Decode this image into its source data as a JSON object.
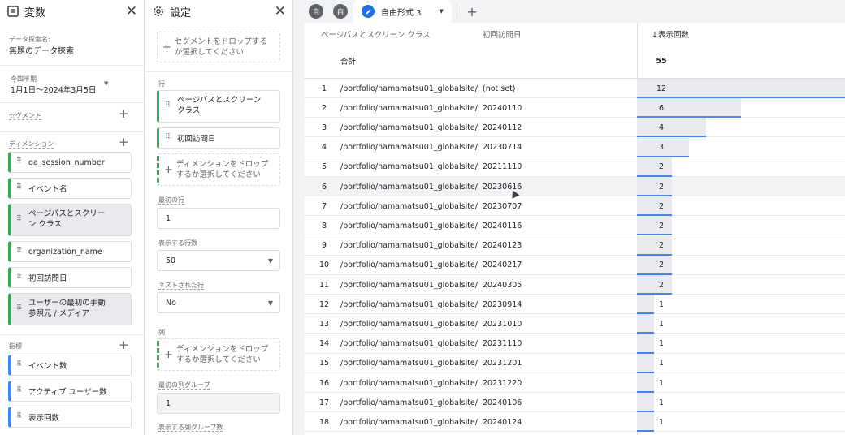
{
  "variables": {
    "title": "変数",
    "exploration_label": "データ探索名:",
    "exploration_name": "無題のデータ探索",
    "date_preset": "今四半期",
    "date_range": "1月1日～2024年3月5日",
    "segments_label": "セグメント",
    "dimensions_label": "ディメンション",
    "dimensions": [
      "ga_session_number",
      "イベント名",
      "ページパスとスクリーン クラス",
      "organization_name",
      "初回訪問日",
      "ユーザーの最初の手動参照元 / メディア"
    ],
    "metrics_label": "指標",
    "metrics": [
      "イベント数",
      "アクティブ ユーザー数",
      "表示回数"
    ]
  },
  "settings": {
    "title": "設定",
    "segment_drop": "セグメントをドロップするか選択してください",
    "rows_label": "行",
    "rows": [
      "ページパスとスクリーン クラス",
      "初回訪問日"
    ],
    "dimension_drop": "ディメンションをドロップするか選択してください",
    "first_row_label": "最初の行",
    "first_row_value": "1",
    "show_rows_label": "表示する行数",
    "show_rows_value": "50",
    "nested_label": "ネストされた行",
    "nested_value": "No",
    "columns_label": "列",
    "column_drop": "ディメンションをドロップするか選択してください",
    "first_col_group_label": "最初の列グループ",
    "first_col_group_value": "1",
    "show_col_groups_label": "表示する列グループ数"
  },
  "tabs": {
    "icon1": "自",
    "icon2": "自",
    "active_label": "自由形式 3"
  },
  "table": {
    "header_dim1": "ページパスとスクリーン クラス",
    "header_dim2": "初回訪問日",
    "header_metric": "↓表示回数",
    "total_label": "合計",
    "total_value": "55",
    "rows": [
      {
        "n": "1",
        "path": "/portfolio/hamamatsu01_globalsite/",
        "date": "(not set)",
        "views": "12",
        "v": 12
      },
      {
        "n": "2",
        "path": "/portfolio/hamamatsu01_globalsite/",
        "date": "20240110",
        "views": "6",
        "v": 6
      },
      {
        "n": "3",
        "path": "/portfolio/hamamatsu01_globalsite/",
        "date": "20240112",
        "views": "4",
        "v": 4
      },
      {
        "n": "4",
        "path": "/portfolio/hamamatsu01_globalsite/",
        "date": "20230714",
        "views": "3",
        "v": 3
      },
      {
        "n": "5",
        "path": "/portfolio/hamamatsu01_globalsite/",
        "date": "20211110",
        "views": "2",
        "v": 2
      },
      {
        "n": "6",
        "path": "/portfolio/hamamatsu01_globalsite/",
        "date": "20230616",
        "views": "2",
        "v": 2
      },
      {
        "n": "7",
        "path": "/portfolio/hamamatsu01_globalsite/",
        "date": "20230707",
        "views": "2",
        "v": 2
      },
      {
        "n": "8",
        "path": "/portfolio/hamamatsu01_globalsite/",
        "date": "20240116",
        "views": "2",
        "v": 2
      },
      {
        "n": "9",
        "path": "/portfolio/hamamatsu01_globalsite/",
        "date": "20240123",
        "views": "2",
        "v": 2
      },
      {
        "n": "10",
        "path": "/portfolio/hamamatsu01_globalsite/",
        "date": "20240217",
        "views": "2",
        "v": 2
      },
      {
        "n": "11",
        "path": "/portfolio/hamamatsu01_globalsite/",
        "date": "20240305",
        "views": "2",
        "v": 2
      },
      {
        "n": "12",
        "path": "/portfolio/hamamatsu01_globalsite/",
        "date": "20230914",
        "views": "1",
        "v": 1
      },
      {
        "n": "13",
        "path": "/portfolio/hamamatsu01_globalsite/",
        "date": "20231010",
        "views": "1",
        "v": 1
      },
      {
        "n": "14",
        "path": "/portfolio/hamamatsu01_globalsite/",
        "date": "20231110",
        "views": "1",
        "v": 1
      },
      {
        "n": "15",
        "path": "/portfolio/hamamatsu01_globalsite/",
        "date": "20231201",
        "views": "1",
        "v": 1
      },
      {
        "n": "16",
        "path": "/portfolio/hamamatsu01_globalsite/",
        "date": "20231220",
        "views": "1",
        "v": 1
      },
      {
        "n": "17",
        "path": "/portfolio/hamamatsu01_globalsite/",
        "date": "20240106",
        "views": "1",
        "v": 1
      },
      {
        "n": "18",
        "path": "/portfolio/hamamatsu01_globalsite/",
        "date": "20240124",
        "views": "1",
        "v": 1
      }
    ],
    "max_value": 12
  },
  "colors": {
    "dimension_accent": "#34a853",
    "metric_accent": "#4285f4",
    "bar_fill": "#e8eaed",
    "bar_line": "#4285f4",
    "active_tab_icon": "#1a73e8"
  }
}
